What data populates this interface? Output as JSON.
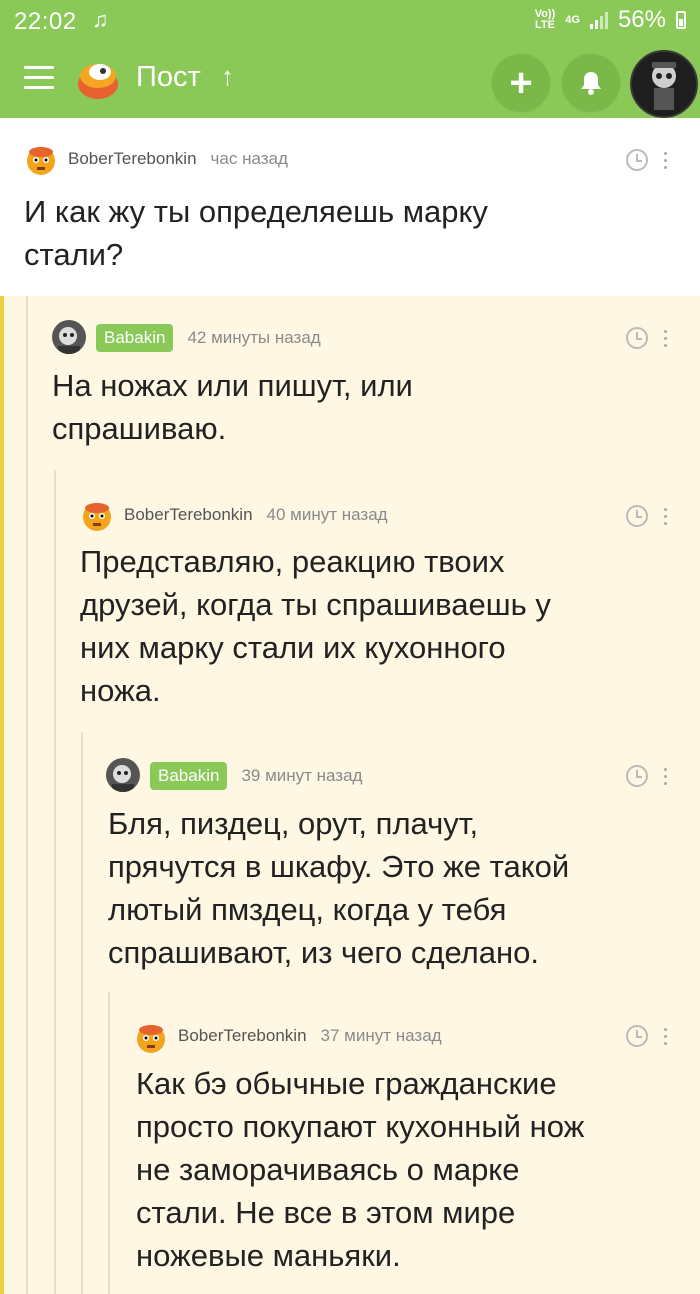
{
  "status": {
    "time": "22:02",
    "music_icon": "music-note-icon",
    "volte": "Vo))",
    "lte": "LTE",
    "net": "4G",
    "battery": "56%"
  },
  "appbar": {
    "title": "Пост",
    "arrow": "↑",
    "add_icon": "plus-icon",
    "bell_icon": "bell-icon"
  },
  "colors": {
    "green": "#8ac858",
    "thread_bg": "#fdf7e3",
    "yellow_bar": "#f0d040"
  },
  "comments": [
    {
      "author": "BoberTerebonkin",
      "time": "час назад",
      "text_line1": "И как жу ты определяешь марку",
      "text_line2": "стали?"
    },
    {
      "author": "Babakin",
      "time": "42 минуты назад",
      "text_line1": "На ножах или пишут, или",
      "text_line2": "спрашиваю."
    },
    {
      "author": "BoberTerebonkin",
      "time": "40 минут назад",
      "text_line1": "Представляю, реакцию твоих",
      "text_line2": "друзей, когда ты спрашиваешь у",
      "text_line3": "них марку стали их кухонного",
      "text_line4": "ножа."
    },
    {
      "author": "Babakin",
      "time": "39 минут назад",
      "text_line1": "Бля, пиздец, орут, плачут,",
      "text_line2": "прячутся в шкафу. Это же такой",
      "text_line3": "лютый пмздец, когда у тебя",
      "text_line4": "спрашивают, из чего сделано."
    },
    {
      "author": "BoberTerebonkin",
      "time": "37 минут назад",
      "text_line1": "Как бэ обычные гражданские",
      "text_line2": "просто покупают кухонный нож",
      "text_line3": "не заморачиваясь о марке",
      "text_line4": "стали. Не все в этом мире",
      "text_line5": "ножевые маньяки."
    }
  ]
}
